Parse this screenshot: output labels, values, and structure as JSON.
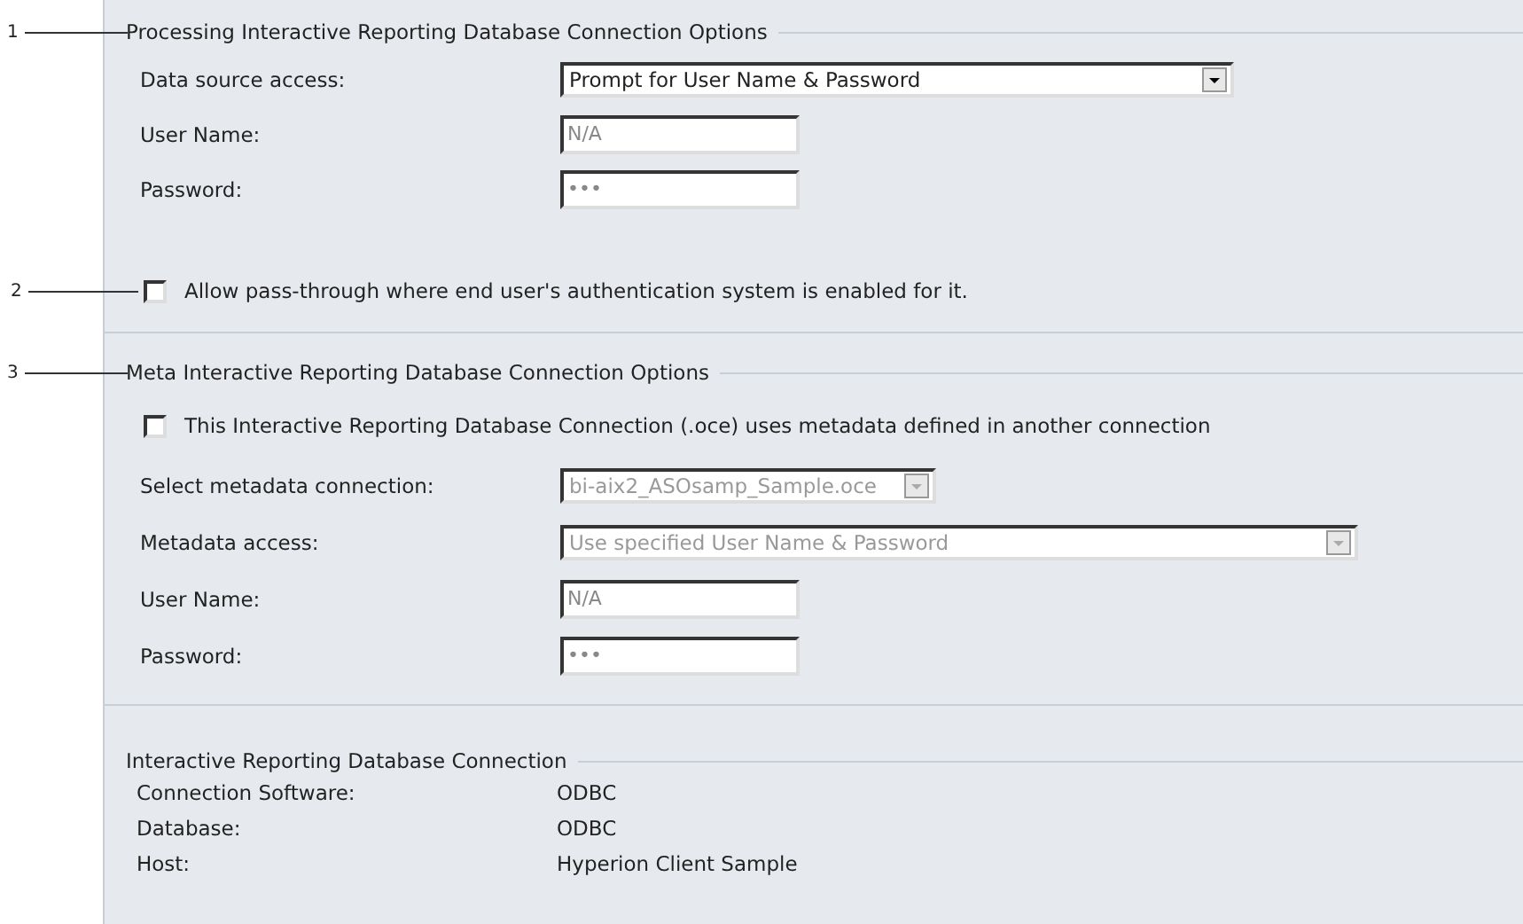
{
  "sections": [
    {
      "legend": "Processing Interactive Reporting Database Connection Options",
      "callout": "1",
      "items": [
        {
          "kind": "select",
          "label": "Data source access:",
          "value": "Prompt for User Name & Password",
          "disabled": false
        },
        {
          "kind": "input",
          "label": "User Name:",
          "value": "N/A",
          "disabled": true
        },
        {
          "kind": "input",
          "label": "Password:",
          "value": "•••",
          "disabled": true
        },
        {
          "kind": "checkbox",
          "label": "Allow pass-through where end user's authentication system is enabled for it.",
          "checked": false,
          "callout": "2"
        }
      ]
    },
    {
      "legend": "Meta Interactive Reporting Database Connection Options",
      "callout": "3",
      "items": [
        {
          "kind": "checkbox",
          "label": "This Interactive Reporting Database Connection (.oce) uses metadata defined in another connection",
          "checked": false
        },
        {
          "kind": "select",
          "label": "Select metadata connection:",
          "value": "bi-aix2_ASOsamp_Sample.oce",
          "disabled": true
        },
        {
          "kind": "select",
          "label": "Metadata access:",
          "value": "Use specified User Name & Password",
          "disabled": true
        },
        {
          "kind": "input",
          "label": "User Name:",
          "value": "N/A",
          "disabled": true
        },
        {
          "kind": "input",
          "label": "Password:",
          "value": "•••",
          "disabled": true
        }
      ]
    },
    {
      "legend": "Interactive Reporting Database Connection",
      "items": [
        {
          "kind": "info",
          "label": "Connection Software:",
          "value": "ODBC"
        },
        {
          "kind": "info",
          "label": "Database:",
          "value": "ODBC"
        },
        {
          "kind": "info",
          "label": "Host:",
          "value": "Hyperion Client Sample"
        }
      ]
    }
  ]
}
